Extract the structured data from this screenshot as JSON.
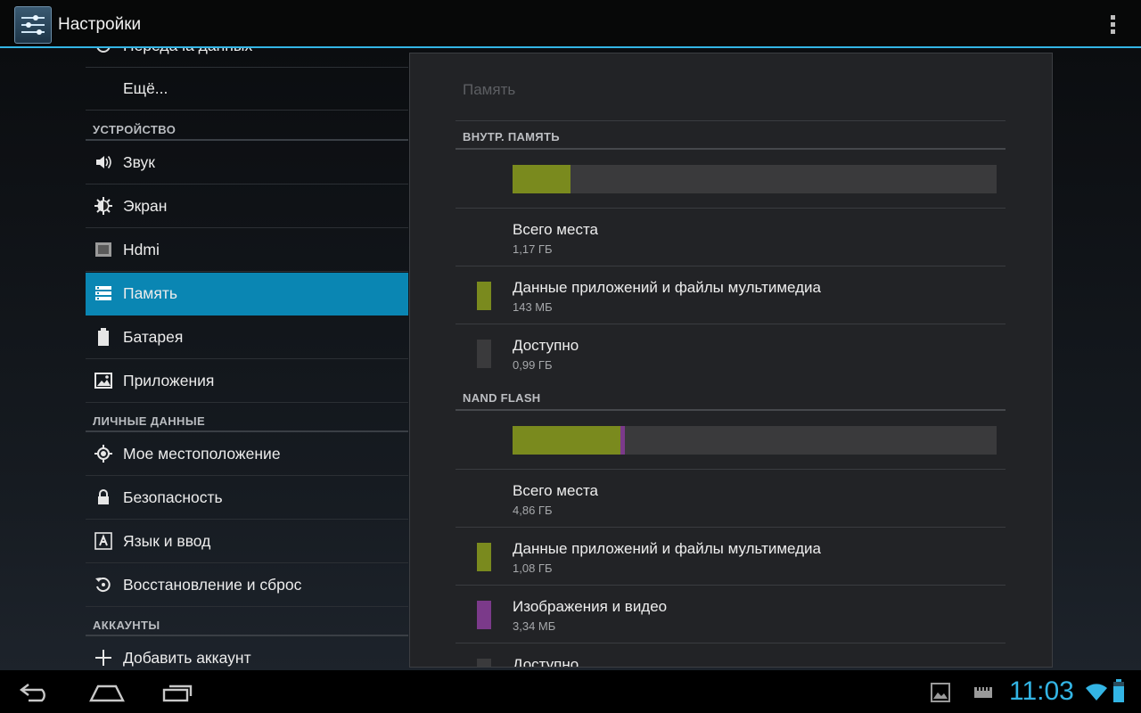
{
  "action_bar": {
    "title": "Настройки"
  },
  "left_list": {
    "partial_item": "Передача данных",
    "items_top": [
      {
        "label": "Ещё..."
      }
    ],
    "sections": {
      "device": "УСТРОЙСТВО",
      "personal": "ЛИЧНЫЕ ДАННЫЕ",
      "accounts": "АККАУНТЫ"
    },
    "device_items": [
      {
        "label": "Звук",
        "icon": "volume-icon"
      },
      {
        "label": "Экран",
        "icon": "brightness-icon"
      },
      {
        "label": "Hdmi",
        "icon": "hdmi-icon"
      },
      {
        "label": "Память",
        "icon": "storage-icon",
        "selected": true
      },
      {
        "label": "Батарея",
        "icon": "battery-icon"
      },
      {
        "label": "Приложения",
        "icon": "apps-icon"
      }
    ],
    "personal_items": [
      {
        "label": "Мое местоположение",
        "icon": "location-icon"
      },
      {
        "label": "Безопасность",
        "icon": "lock-icon"
      },
      {
        "label": "Язык и ввод",
        "icon": "language-icon"
      },
      {
        "label": "Восстановление и сброс",
        "icon": "restore-icon"
      }
    ],
    "account_items": [
      {
        "label": "Добавить аккаунт",
        "icon": "add-icon"
      }
    ]
  },
  "storage": {
    "title": "Память",
    "internal": {
      "header": "ВНУТР. ПАМЯТЬ",
      "usage": {
        "apps_fraction": 0.12
      },
      "total": {
        "label": "Всего места",
        "value": "1,17 ГБ"
      },
      "apps": {
        "label": "Данные приложений и файлы мультимедиа",
        "value": "143 МБ"
      },
      "available": {
        "label": "Доступно",
        "value": "0,99 ГБ"
      }
    },
    "nand": {
      "header": "NAND FLASH",
      "usage": {
        "apps_fraction": 0.222,
        "images_fraction": 0.01
      },
      "total": {
        "label": "Всего места",
        "value": "4,86 ГБ"
      },
      "apps": {
        "label": "Данные приложений и файлы мультимедиа",
        "value": "1,08 ГБ"
      },
      "images": {
        "label": "Изображения и видео",
        "value": "3,34 МБ"
      },
      "available_partial": {
        "label": "Доступно"
      }
    },
    "colors": {
      "apps": "#7a8a1e",
      "images": "#7b3a8a",
      "free": "#3a3a3c"
    }
  },
  "navbar": {
    "clock": "11:03"
  }
}
